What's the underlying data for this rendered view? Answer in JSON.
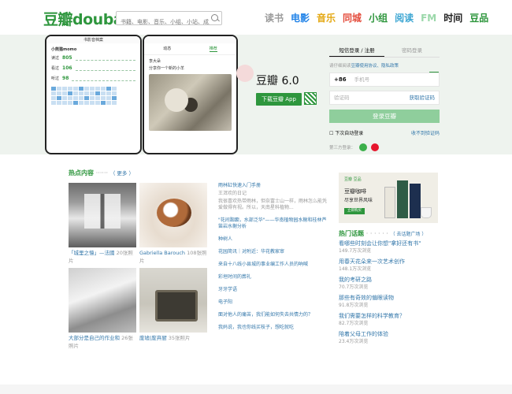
{
  "header": {
    "logo_cn": "豆瓣",
    "logo_en": "douban",
    "search_placeholder": "书籍、电影、音乐、小组、小站、成员",
    "nav": [
      {
        "label": "读书",
        "color": "#9b9b9b"
      },
      {
        "label": "电影",
        "color": "#2384e8"
      },
      {
        "label": "音乐",
        "color": "#e4a813"
      },
      {
        "label": "同城",
        "color": "#e44c3c"
      },
      {
        "label": "小组",
        "color": "#2e963d"
      },
      {
        "label": "阅读",
        "color": "#3fa7d3"
      },
      {
        "label": "FM",
        "color": "#9bd8aa"
      },
      {
        "label": "时间",
        "color": "#222222"
      },
      {
        "label": "豆品",
        "color": "#2e963d"
      }
    ]
  },
  "hero": {
    "phone1": {
      "title": "书影音档案",
      "user": "小熊猫momo",
      "stats": [
        {
          "label": "读过",
          "value": "805"
        },
        {
          "label": "看过",
          "value": "106"
        },
        {
          "label": "听过",
          "value": "98"
        }
      ]
    },
    "phone2": {
      "tab_a": "动态",
      "tab_b": "推荐",
      "post_user": "李大朵",
      "post_text": "分享你一个新的小羊"
    },
    "app_title": "豆瓣 6.0",
    "download_label": "下载豆瓣 App"
  },
  "login": {
    "tab_sms": "短信登录 / 注册",
    "tab_password": "密码登录",
    "hint_prefix": "请仔细阅读",
    "hint_link": "豆瓣使用协议、隐私政策",
    "country_code": "+86",
    "phone_placeholder": "手机号",
    "code_placeholder": "验证码",
    "get_code": "获取验证码",
    "submit": "登录豆瓣",
    "auto_login": "下次自动登录",
    "no_code": "收不到验证码",
    "third_party": "第三方登录："
  },
  "hot": {
    "title": "热点内容",
    "more": "（ 更多 ）",
    "photos": [
      {
        "title": "「城里之憶」—法國",
        "count": "20张照片"
      },
      {
        "title": "Gabriella Barouch",
        "count": "108张照片"
      },
      {
        "title": "大部分是自己的作业和",
        "count": "26张照片"
      },
      {
        "title": "废墟|废弃厨",
        "count": "35张照片"
      }
    ],
    "list": [
      {
        "title": "雨林缸快速入门手册",
        "sub": "王洱欢的日记",
        "body": "我很喜欢热带雨林，但奈富士山一样，雨林怎么能凭爱做得有视。所以，天南星科植物..."
      },
      {
        "title": "\"花间踟蹰，水部泛华\"——华南植物园水榭和桂林芦笛岩水榭分析"
      },
      {
        "title": "种树人"
      },
      {
        "title": "花园简讯｜对附近：华花教家审"
      },
      {
        "title": "来自十八线小县城的事业编工作人员的吶喊"
      },
      {
        "title": "彩垣时间的葬礼"
      },
      {
        "title": "牙牙学语"
      },
      {
        "title": "电子阳"
      },
      {
        "title": "面对他人的痛苦，我们能如何失去共情力的？"
      },
      {
        "title": "我妈说，我也你线买枝子，想吃就吃"
      }
    ]
  },
  "ad": {
    "logo": "豆瓣 豆品",
    "line1": "豆瓣咖啡",
    "line2": "尽享世界风味",
    "cta": "立即购买"
  },
  "topics": {
    "title": "热门话题",
    "more": "（ 去话题广场 ）",
    "items": [
      {
        "title": "看哪些时刻会让你想\"拿好还有书\"",
        "views": "149.7万次浏览"
      },
      {
        "title": "用春天花朵来一次艺术创作",
        "views": "148.1万次浏览"
      },
      {
        "title": "我的考研之路",
        "views": "70.7万次浏览"
      },
      {
        "title": "那些有奇效的偏眼读物",
        "views": "91.8万次浏览"
      },
      {
        "title": "我们需要怎样的科学教育？",
        "views": "82.7万次浏览"
      },
      {
        "title": "陪着父母工作的体验",
        "views": "23.4万次浏览"
      }
    ]
  }
}
